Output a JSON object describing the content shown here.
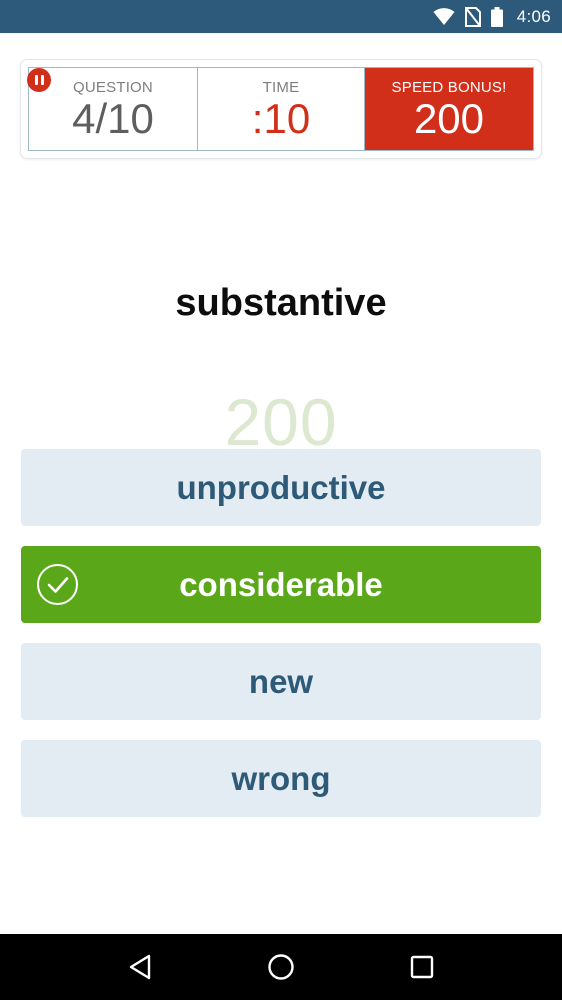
{
  "status_bar": {
    "time": "4:06",
    "icons": [
      "wifi-icon",
      "no-sim-icon",
      "battery-icon"
    ]
  },
  "score_panel": {
    "question_label": "QUESTION",
    "question_value": "4/10",
    "time_label": "TIME",
    "time_value": ":10",
    "bonus_label": "SPEED BONUS!",
    "bonus_value": "200"
  },
  "quiz": {
    "word": "substantive",
    "points_earned": "200",
    "answers": [
      {
        "label": "unproductive",
        "state": "default"
      },
      {
        "label": "considerable",
        "state": "correct"
      },
      {
        "label": "new",
        "state": "default"
      },
      {
        "label": "wrong",
        "state": "default"
      }
    ]
  },
  "colors": {
    "status_bar": "#2d5a7b",
    "accent_red": "#d12f19",
    "correct_green": "#5aa81a",
    "answer_bg": "#e2ecf2",
    "answer_text": "#2e5a78"
  },
  "nav_bar": {
    "icons": [
      "back-icon",
      "home-icon",
      "recents-icon"
    ]
  }
}
